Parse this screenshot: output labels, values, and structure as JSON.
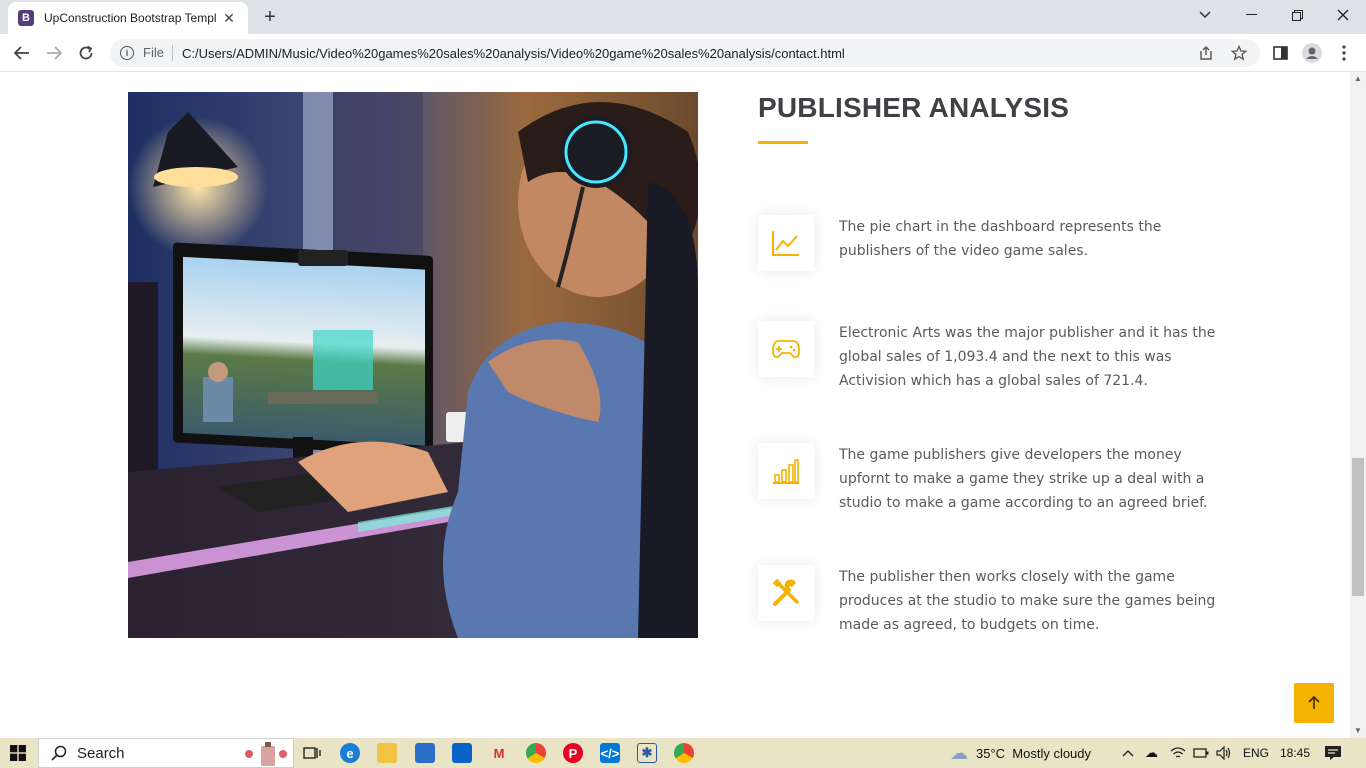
{
  "browser": {
    "tab_title": "UpConstruction Bootstrap Templ",
    "favicon_letter": "B",
    "file_label": "File",
    "url": "C:/Users/ADMIN/Music/Video%20games%20sales%20analysis/Video%20game%20sales%20analysis/contact.html"
  },
  "section": {
    "heading": "PUBLISHER ANALYSIS",
    "accent_color": "#f5b301",
    "features": [
      {
        "icon": "line-chart-icon",
        "text": "The pie chart in the dashboard represents the publishers of the video game sales."
      },
      {
        "icon": "gamepad-icon",
        "text": "Electronic Arts was the major publisher and it has the global sales of 1,093.4 and the next to this was Activision which has a global sales of 721.4."
      },
      {
        "icon": "bar-chart-icon",
        "text": "The game publishers give developers the money upfornt to make a game they strike up a deal with a studio to make a game according to an agreed brief."
      },
      {
        "icon": "tools-icon",
        "text": "The publisher then works closely with the game produces at the studio to make sure the games being made as agreed, to budgets on time."
      }
    ]
  },
  "taskbar": {
    "search_label": "Search",
    "weather": "35°C  Mostly cloudy",
    "language": "ENG",
    "time": "18:45"
  }
}
